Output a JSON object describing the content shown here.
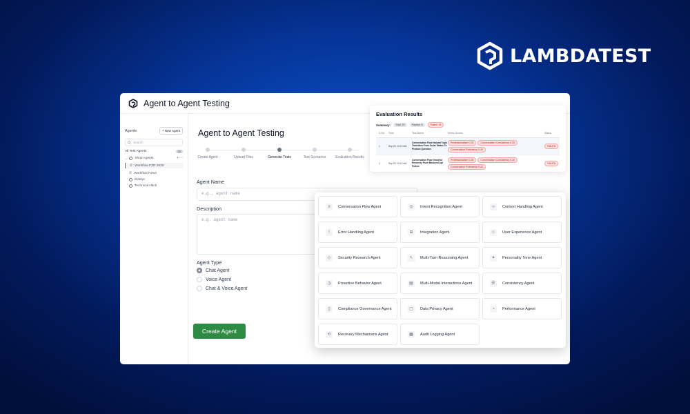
{
  "brand": {
    "name": "LAMBDATEST",
    "logo_icon": "lambdatest-logo-icon"
  },
  "app": {
    "title": "Agent to Agent Testing",
    "logo_icon": "app-logo-icon"
  },
  "sidebar": {
    "title": "Agents",
    "new_agent_label": "+ New Agent",
    "search_placeholder": "Search",
    "all_label": "All Test Agents",
    "all_count": "22",
    "items": [
      {
        "label": "Shop Agents",
        "icon": "folder-icon",
        "level": 0,
        "more": "+ ···"
      },
      {
        "label": "Workflow FZR 2030",
        "icon": "phone-icon",
        "level": 1,
        "active": true
      },
      {
        "label": "Workflow FZS4",
        "icon": "phone-icon",
        "level": 1
      },
      {
        "label": "Elastyc",
        "icon": "circle-icon",
        "level": 0
      },
      {
        "label": "Technical Hitch",
        "icon": "circle-icon",
        "level": 0
      }
    ]
  },
  "main": {
    "title": "Agent to Agent Testing",
    "steps": [
      "Create Agent",
      "Upload Files",
      "Generate Tests",
      "Test Scenarios",
      "Evaluation Results"
    ],
    "active_step": 2,
    "agent_name_label": "Agent Name",
    "agent_name_placeholder": "e.g., agent name",
    "description_label": "Description",
    "description_placeholder": "e.g. agent name",
    "agent_type_label": "Agent Type",
    "agent_types": [
      "Chat Agent",
      "Voice Agent",
      "Chat & Voice Agent"
    ],
    "selected_agent_type": 0,
    "create_button": "Create Agent"
  },
  "evaluation": {
    "title": "Evaluation Results",
    "summary_label": "Summary:",
    "summary_chips": [
      {
        "text": "Total: 20",
        "tone": "grey"
      },
      {
        "text": "Passed: 6",
        "tone": "grey"
      },
      {
        "text": "Failed: 14",
        "tone": "red"
      }
    ],
    "columns": [
      "S.No.",
      "Time",
      "Test Name",
      "Metric Scores",
      "Status"
    ],
    "rows": [
      {
        "no": "1",
        "time": "Sep 25, 10:12 AM",
        "name": "Conversation Flow Natural Topic Transition From Order Status To Product Question",
        "metrics": [
          "Professionalism 0.25",
          "Conversation Consistency 0.30",
          "Conversation Relevancy 0.40"
        ],
        "status": "FAILED"
      },
      {
        "no": "2",
        "time": "Sep 25, 10:12 AM",
        "name": "Conversation Flow Graceful Recovery From Backend Api Failure",
        "metrics": [
          "Professionalism 0.35",
          "Conversation Consistency 0.30",
          "Conversation Relevancy 0.40"
        ],
        "status": "FAILED"
      }
    ]
  },
  "catalog": {
    "agents": [
      {
        "label": "Conversation Flow Agent",
        "icon": "chat-flow-icon",
        "glyph": "≡"
      },
      {
        "label": "Intent Recognition Agent",
        "icon": "target-icon",
        "glyph": "◎"
      },
      {
        "label": "Context Handling Agent",
        "icon": "code-icon",
        "glyph": "‹›"
      },
      {
        "label": "Error Handling Agent",
        "icon": "alert-icon",
        "glyph": "!"
      },
      {
        "label": "Integration Agent",
        "icon": "puzzle-icon",
        "glyph": "⊞"
      },
      {
        "label": "User Experience Agent",
        "icon": "user-icon",
        "glyph": "☺"
      },
      {
        "label": "Security Research Agent",
        "icon": "shield-icon",
        "glyph": "◇"
      },
      {
        "label": "Multi-Turn Reasoning Agent",
        "icon": "cursor-icon",
        "glyph": "↖"
      },
      {
        "label": "Personality Tone Agent",
        "icon": "persona-icon",
        "glyph": "✦"
      },
      {
        "label": "Proactive Behavior Agent",
        "icon": "clock-icon",
        "glyph": "◷"
      },
      {
        "label": "Multi-Modal Interactions Agent",
        "icon": "layers-icon",
        "glyph": "▤"
      },
      {
        "label": "Consistency Agent",
        "icon": "database-icon",
        "glyph": "☰"
      },
      {
        "label": "Compliance Governance Agent",
        "icon": "document-icon",
        "glyph": "▯"
      },
      {
        "label": "Data Privacy Agent",
        "icon": "lock-icon",
        "glyph": "▢"
      },
      {
        "label": "Performance Agent",
        "icon": "gauge-icon",
        "glyph": "◔"
      },
      {
        "label": "Recovery Mechanisms Agent",
        "icon": "refresh-icon",
        "glyph": "⟲"
      },
      {
        "label": "Audit Logging Agent",
        "icon": "log-icon",
        "glyph": "▦"
      }
    ]
  }
}
